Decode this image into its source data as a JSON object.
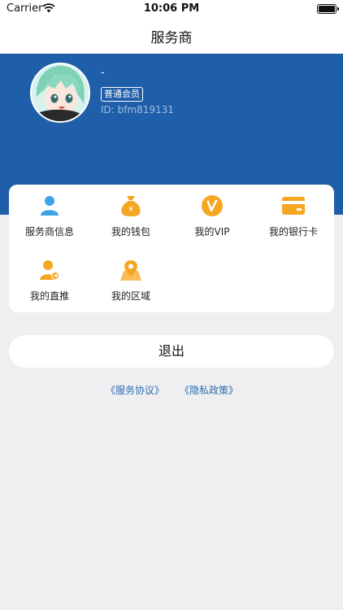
{
  "status_bar": {
    "carrier": "Carrier",
    "time": "10:06 PM"
  },
  "nav": {
    "title": "服务商"
  },
  "profile": {
    "name": "-",
    "badge": "普通会员",
    "id_text": "ID: bfm819131"
  },
  "menu": {
    "items": [
      {
        "label": "服务商信息",
        "icon": "person-icon"
      },
      {
        "label": "我的钱包",
        "icon": "money-bag-icon"
      },
      {
        "label": "我的VIP",
        "icon": "vip-icon"
      },
      {
        "label": "我的银行卡",
        "icon": "bank-card-icon"
      },
      {
        "label": "我的直推",
        "icon": "referral-icon"
      },
      {
        "label": "我的区域",
        "icon": "map-pin-icon"
      }
    ]
  },
  "logout_label": "退出",
  "agreements": {
    "service": "《服务协议》",
    "privacy": "《隐私政策》"
  },
  "colors": {
    "header_blue": "#1f5ea9",
    "icon_orange": "#f5a623",
    "icon_blue": "#3da3e8",
    "link_blue": "#2e6ab4"
  }
}
